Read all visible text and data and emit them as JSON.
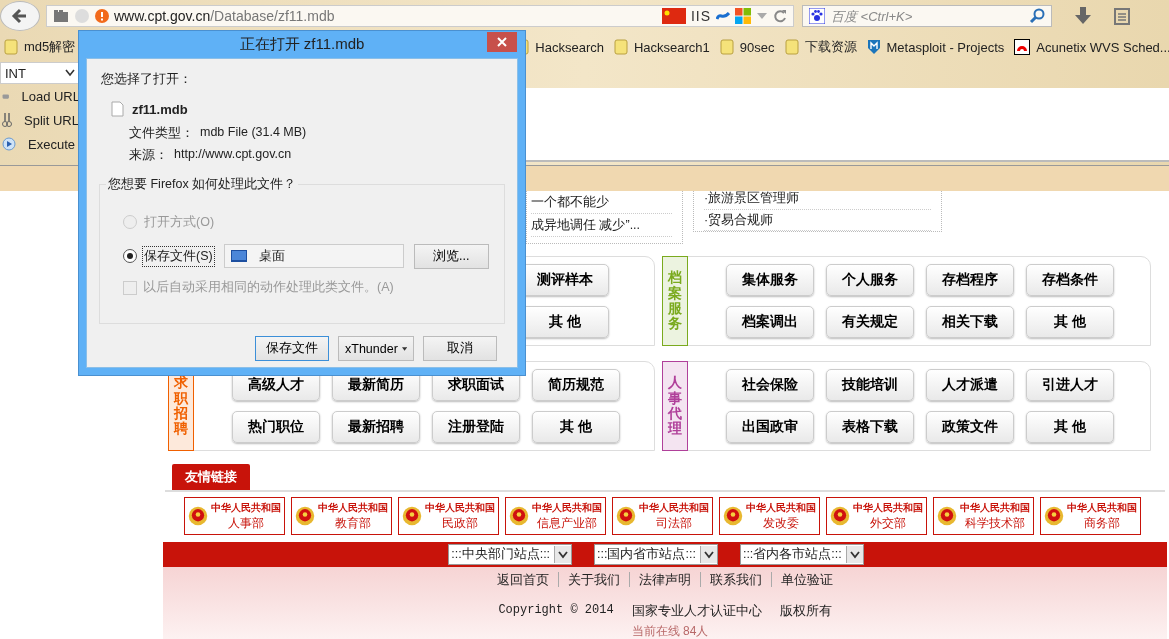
{
  "browser": {
    "url_host": "www.cpt.gov.cn",
    "url_path": "/Database/zf11.mdb",
    "server_tag": "IIS",
    "search_placeholder": "百度 <Ctrl+K>"
  },
  "bookmarks": [
    {
      "label": "md5解密",
      "kind": "folder"
    },
    {
      "label": "Hacksearch",
      "kind": "folder"
    },
    {
      "label": "Hacksearch1",
      "kind": "folder"
    },
    {
      "label": "90sec",
      "kind": "folder"
    },
    {
      "label": "下载资源",
      "kind": "folder"
    },
    {
      "label": "Metasploit - Projects",
      "kind": "shield"
    },
    {
      "label": "Acunetix WVS Sched...",
      "kind": "acunetix"
    }
  ],
  "hackbar": {
    "select": "INT",
    "actions": [
      {
        "label": "Load URL",
        "kind": "load"
      },
      {
        "label": "Split URL",
        "kind": "split"
      },
      {
        "label": "Execute",
        "kind": "execute"
      }
    ]
  },
  "news_boxes": [
    {
      "lines": [
        "一个都不能少",
        "成异地调任  减少”..."
      ]
    },
    {
      "lines": [
        "·旅游景区管理师",
        "·贸易合规师"
      ]
    }
  ],
  "sections": [
    [
      {
        "buttons": [
          "测评样本",
          "其 他"
        ]
      },
      {
        "label": "档案服务",
        "color": "#7aaa1e",
        "buttons": [
          "集体服务",
          "个人服务",
          "存档程序",
          "存档条件",
          "档案调出",
          "有关规定",
          "相关下载",
          "其 他"
        ]
      }
    ],
    [
      {
        "label": "求职招聘",
        "color": "#f06000",
        "buttons": [
          "高级人才",
          "最新简历",
          "求职面试",
          "简历规范",
          "热门职位",
          "最新招聘",
          "注册登陆",
          "其 他"
        ]
      },
      {
        "label": "人事代理",
        "color": "#b0409a",
        "buttons": [
          "社会保险",
          "技能培训",
          "人才派遣",
          "引进人才",
          "出国政审",
          "表格下载",
          "政策文件",
          "其 他"
        ]
      }
    ]
  ],
  "links_title": "友情链接",
  "ministries": [
    {
      "top": "中华人民共和国",
      "name": "人事部"
    },
    {
      "top": "中华人民共和国",
      "name": "教育部"
    },
    {
      "top": "中华人民共和国",
      "name": "民政部"
    },
    {
      "top": "中华人民共和国",
      "name": "信息产业部"
    },
    {
      "top": "中华人民共和国",
      "name": "司法部"
    },
    {
      "top": "中华人民共和国",
      "name": "发改委"
    },
    {
      "top": "中华人民共和国",
      "name": "外交部"
    },
    {
      "top": "中华人民共和国",
      "name": "科学技术部"
    },
    {
      "top": "中华人民共和国",
      "name": "商务部"
    }
  ],
  "site_selects": [
    ":::中央部门站点:::",
    ":::国内省市站点:::",
    ":::省内各市站点:::"
  ],
  "footer_links": [
    "返回首页",
    "关于我们",
    "法律声明",
    "联系我们",
    "单位验证"
  ],
  "copyright": "Copyright © 2014",
  "organization": "国家专业人才认证中心",
  "rights": "版权所有",
  "online": "当前在线 84人",
  "dialog": {
    "title": "正在打开 zf11.mdb",
    "intro": "您选择了打开：",
    "file_name": "zf11.mdb",
    "type_label": "文件类型：",
    "type_value": "mdb File (31.4 MB)",
    "source_label": "来源：",
    "source_value": "http://www.cpt.gov.cn",
    "group_title": "您想要 Firefox 如何处理此文件？",
    "options": [
      {
        "label": "打开方式(O)",
        "selected": false,
        "disabled": true
      },
      {
        "label": "保存文件(S)",
        "selected": true,
        "disabled": false
      }
    ],
    "save_location": "桌面",
    "browse": "浏览...",
    "remember": {
      "label": "以后自动采用相同的动作处理此类文件。(A)",
      "checked": false,
      "disabled": true
    },
    "buttons": [
      {
        "label": "保存文件",
        "kind": "default"
      },
      {
        "label": "xThunder",
        "kind": "menu"
      },
      {
        "label": "取消",
        "kind": "plain"
      }
    ]
  }
}
